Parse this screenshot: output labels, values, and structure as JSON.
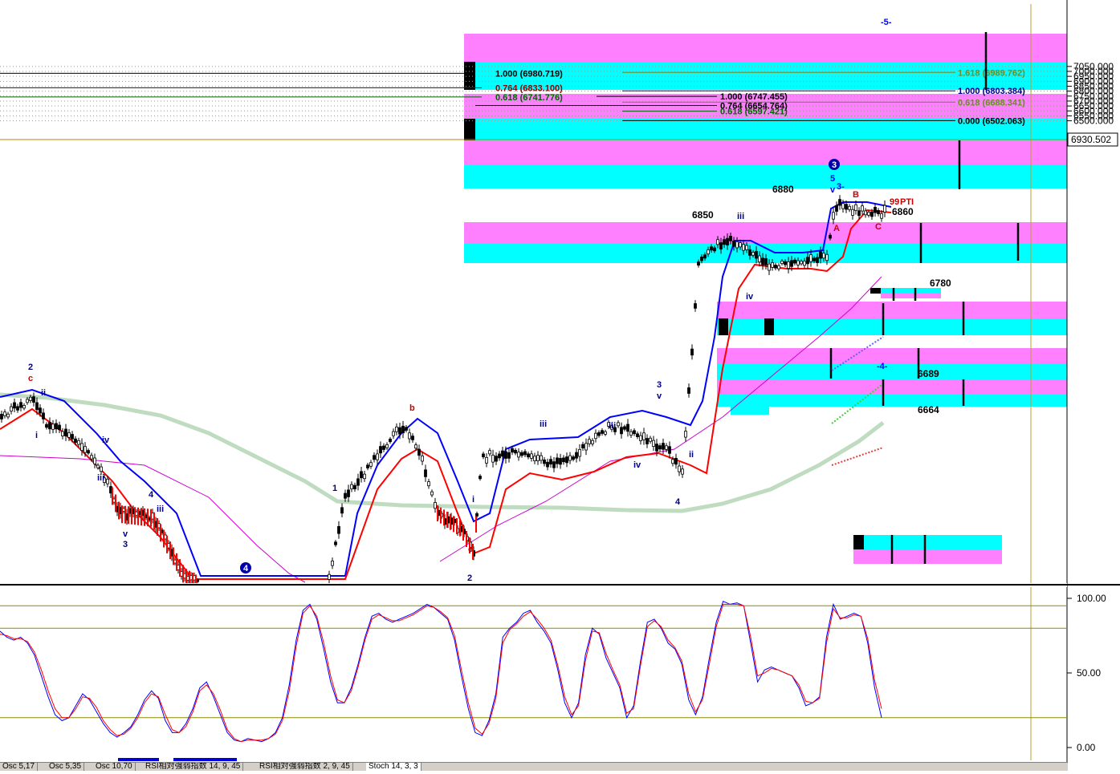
{
  "chart_data": [
    {
      "type": "candlestick",
      "title": "",
      "y_axis": {
        "ticks": [
          "7050.000",
          "7000.000",
          "6950.000",
          "6900.000",
          "6850.000",
          "6800.000",
          "6750.000",
          "6700.000",
          "6650.000",
          "6600.000",
          "6550.000",
          "6500.000"
        ],
        "range": [
          6498,
          7065
        ],
        "current_price_label": "6930.502"
      },
      "grid": true,
      "price_levels": [
        {
          "label": "1.000 (6980.719)",
          "value": 6980.719,
          "color": "#000000"
        },
        {
          "label": "0.764 (6833.100)",
          "value": 6833.1,
          "color": "#8b0000"
        },
        {
          "label": "0.618 (6741.776)",
          "value": 6741.776,
          "color": "#006400"
        },
        {
          "label": "1.618 (6989.762)",
          "value": 6989.762,
          "color": "#6b8e23"
        },
        {
          "label": "1.000 (6803.384)",
          "value": 6803.384,
          "color": "#00008b"
        },
        {
          "label": "1.000 (6747.455)",
          "value": 6747.455,
          "color": "#000000"
        },
        {
          "label": "0.618 (6688.341)",
          "value": 6688.341,
          "color": "#6b8e23"
        },
        {
          "label": "0.764 (6654.764)",
          "value": 6654.764,
          "color": "#000000"
        },
        {
          "label": "0.618 (6597.421)",
          "value": 6597.421,
          "color": "#006400"
        },
        {
          "label": "0.000 (6502.063)",
          "value": 6502.063,
          "color": "#000000"
        }
      ],
      "price_annotations": [
        "6880",
        "6850",
        "6860",
        "6780",
        "6689",
        "6664"
      ],
      "wave_labels": [
        "2",
        "c",
        "ii",
        "i",
        "iv",
        "iii",
        "v",
        "3",
        "4",
        "iii",
        "1",
        "b",
        "iii",
        "i",
        "c",
        "2",
        "3",
        "v",
        "iii",
        "iv",
        "ii",
        "4",
        "iii",
        "iv",
        "5",
        "v",
        "3-",
        "B",
        "A",
        "C",
        "-5-",
        "-4-",
        "99",
        "PTI"
      ],
      "circled_labels": [
        "4",
        "3"
      ],
      "colors": {
        "fib_magenta": "#ff80ff",
        "fib_cyan": "#00ffff",
        "price_bars": "#000000",
        "blue_band": "#0000ff",
        "red_band": "#ff0000",
        "moving_average": "#c0dcc0",
        "long_average": "#cc00cc"
      }
    },
    {
      "type": "line",
      "title": "",
      "y_axis": {
        "ticks": [
          "100.00",
          "50.00",
          "0.00"
        ],
        "range": [
          0,
          100
        ]
      },
      "reference_lines": [
        95,
        80,
        20
      ],
      "series_colors": [
        "#0000ff",
        "#ff0000"
      ],
      "series": [
        {
          "values": [
            78,
            74,
            72,
            74,
            70,
            62,
            48,
            34,
            22,
            18,
            20,
            28,
            36,
            32,
            24,
            16,
            10,
            7,
            10,
            14,
            22,
            32,
            38,
            33,
            18,
            10,
            10,
            16,
            26,
            40,
            44,
            34,
            22,
            10,
            5,
            4,
            6,
            5,
            4,
            6,
            10,
            20,
            42,
            72,
            92,
            96,
            86,
            66,
            44,
            30,
            30,
            40,
            56,
            74,
            88,
            90,
            86,
            84,
            86,
            88,
            90,
            93,
            96,
            94,
            90,
            86,
            72,
            48,
            26,
            10,
            8,
            18,
            36,
            74,
            80,
            84,
            90,
            92,
            84,
            78,
            70,
            52,
            30,
            20,
            30,
            62,
            80,
            76,
            60,
            50,
            40,
            20,
            28,
            58,
            84,
            86,
            80,
            70,
            66,
            56,
            32,
            22,
            34,
            60,
            84,
            98,
            96,
            97,
            95,
            70,
            44,
            52,
            54,
            52,
            50,
            48,
            40,
            28,
            30,
            34,
            74,
            96,
            86,
            88,
            90,
            88,
            70,
            40,
            20
          ]
        },
        {
          "values": [
            76,
            75,
            73,
            73,
            71,
            64,
            52,
            38,
            26,
            20,
            20,
            26,
            34,
            33,
            27,
            18,
            12,
            8,
            9,
            13,
            20,
            30,
            36,
            34,
            22,
            12,
            10,
            14,
            24,
            38,
            42,
            36,
            25,
            12,
            6,
            4,
            5,
            5,
            5,
            6,
            9,
            18,
            38,
            68,
            90,
            95,
            88,
            70,
            48,
            32,
            30,
            38,
            54,
            72,
            86,
            89,
            87,
            85,
            85,
            87,
            89,
            92,
            95,
            94,
            91,
            87,
            75,
            52,
            30,
            13,
            9,
            16,
            33,
            70,
            79,
            83,
            88,
            91,
            86,
            80,
            72,
            55,
            34,
            22,
            28,
            58,
            78,
            77,
            63,
            52,
            42,
            23,
            26,
            55,
            81,
            85,
            81,
            72,
            67,
            58,
            36,
            24,
            32,
            56,
            81,
            96,
            96,
            96,
            95,
            74,
            48,
            50,
            53,
            52,
            50,
            48,
            42,
            31,
            30,
            33,
            70,
            93,
            87,
            87,
            89,
            88,
            73,
            45,
            26
          ]
        }
      ]
    }
  ],
  "tabs": [
    "Osc 5,17",
    "Osc 5,35",
    "Osc 10,70",
    "RSI相対強弱指数 14, 9, 45",
    "RSI相対強弱指数 2, 9, 45",
    "Stoch 14, 3, 3"
  ]
}
